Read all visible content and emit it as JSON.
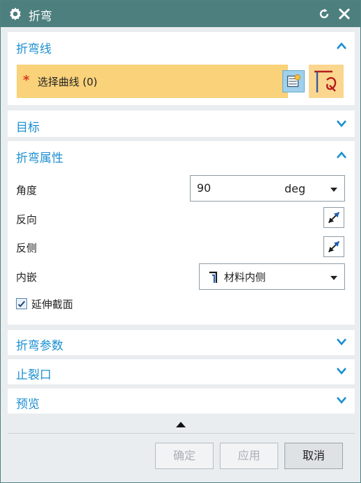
{
  "window": {
    "title": "折弯"
  },
  "sections": {
    "bend_line": {
      "title": "折弯线",
      "select_label": "选择曲线 (0)",
      "required_marker": "*"
    },
    "target": {
      "title": "目标"
    },
    "bend_props": {
      "title": "折弯属性",
      "angle_label": "角度",
      "angle_value": "90",
      "angle_unit": "deg",
      "reverse_label": "反向",
      "flip_side_label": "反侧",
      "inset_label": "内嵌",
      "inset_value": "材料内侧",
      "extend_section_label": "延伸截面",
      "extend_section_checked": true
    },
    "bend_params": {
      "title": "折弯参数"
    },
    "relief": {
      "title": "止裂口"
    },
    "preview": {
      "title": "预览"
    }
  },
  "footer": {
    "ok": "确定",
    "apply": "应用",
    "cancel": "取消"
  },
  "colors": {
    "titlebar": "#4e7f7f",
    "section_title": "#1b8fd0",
    "selection_highlight": "#f9d27a"
  }
}
